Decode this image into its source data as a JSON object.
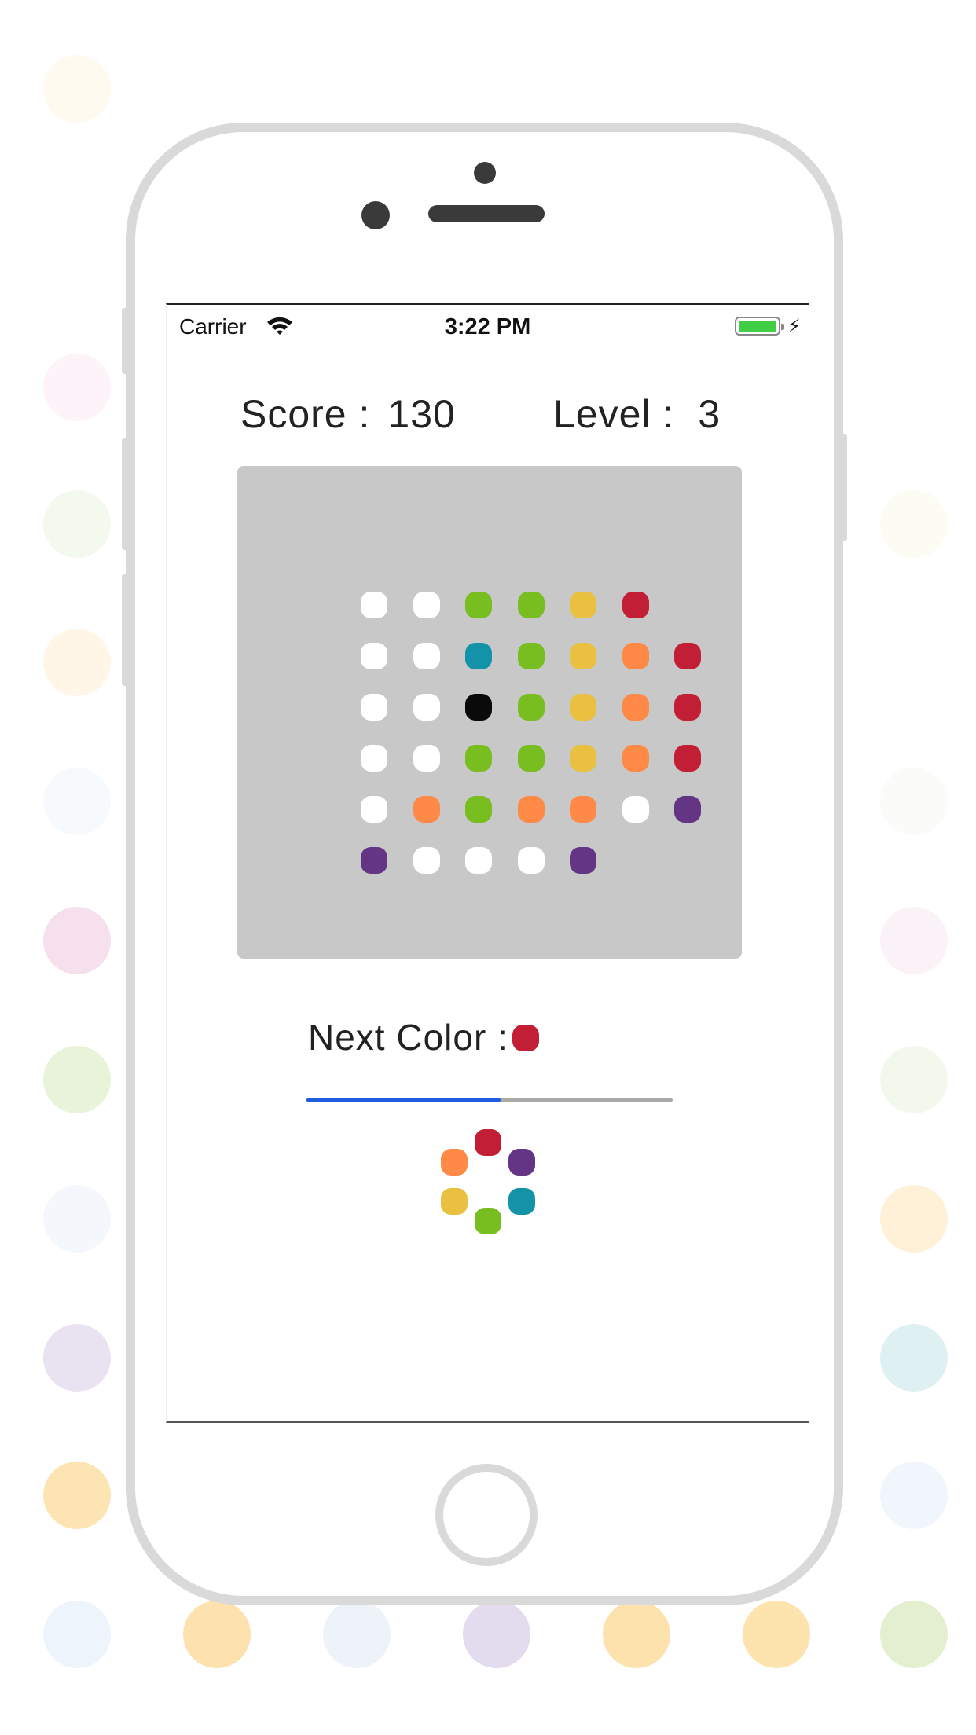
{
  "status_bar": {
    "carrier": "Carrier",
    "time": "3:22 PM",
    "battery_color": "#3fce46"
  },
  "hud": {
    "score_label": "Score :",
    "score_value": "130",
    "level_label": "Level :",
    "level_value": "3"
  },
  "colors": {
    "W": "#ffffff",
    "G": "#78be20",
    "Y": "#e9c03f",
    "R": "#c21f36",
    "T": "#1493a8",
    "O": "#ff8a48",
    "K": "#0a0a0a",
    "P": "#643584",
    "board_bg": "#c8c8c8",
    "progress_fill": "#1f5ce0",
    "progress_track": "#a9a9a9"
  },
  "board": {
    "rows": [
      [
        "W",
        "W",
        "G",
        "G",
        "Y",
        "R",
        ""
      ],
      [
        "W",
        "W",
        "T",
        "G",
        "Y",
        "O",
        "R"
      ],
      [
        "W",
        "W",
        "K",
        "G",
        "Y",
        "O",
        "R"
      ],
      [
        "W",
        "W",
        "G",
        "G",
        "Y",
        "O",
        "R"
      ],
      [
        "W",
        "O",
        "G",
        "O",
        "O",
        "W",
        "P"
      ],
      [
        "P",
        "W",
        "W",
        "W",
        "P",
        "",
        ""
      ]
    ]
  },
  "next": {
    "label": "Next Color :",
    "color": "R"
  },
  "progress": {
    "value": 0.53
  },
  "color_wheel": [
    "R",
    "P",
    "T",
    "G",
    "Y",
    "O"
  ]
}
